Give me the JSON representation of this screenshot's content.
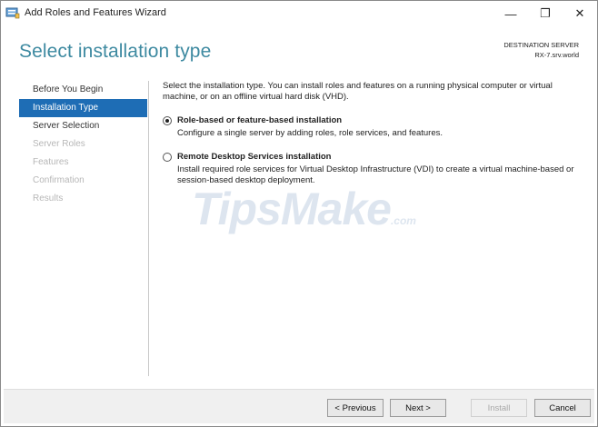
{
  "window": {
    "title": "Add Roles and Features Wizard",
    "controls": {
      "minimize": "—",
      "maximize": "❐",
      "close": "✕"
    }
  },
  "header": {
    "title": "Select installation type",
    "destination_label": "DESTINATION SERVER",
    "destination_server": "RX-7.srv.world"
  },
  "nav": {
    "items": [
      {
        "label": "Before You Begin",
        "state": "normal"
      },
      {
        "label": "Installation Type",
        "state": "active"
      },
      {
        "label": "Server Selection",
        "state": "normal"
      },
      {
        "label": "Server Roles",
        "state": "disabled"
      },
      {
        "label": "Features",
        "state": "disabled"
      },
      {
        "label": "Confirmation",
        "state": "disabled"
      },
      {
        "label": "Results",
        "state": "disabled"
      }
    ]
  },
  "content": {
    "intro": "Select the installation type. You can install roles and features on a running physical computer or virtual machine, or on an offline virtual hard disk (VHD).",
    "options": [
      {
        "title": "Role-based or feature-based installation",
        "description": "Configure a single server by adding roles, role services, and features.",
        "selected": true
      },
      {
        "title": "Remote Desktop Services installation",
        "description": "Install required role services for Virtual Desktop Infrastructure (VDI) to create a virtual machine-based or session-based desktop deployment.",
        "selected": false
      }
    ]
  },
  "watermark": {
    "text": "TipsMake",
    "suffix": ".com"
  },
  "footer": {
    "previous": "< Previous",
    "next": "Next >",
    "install": "Install",
    "cancel": "Cancel"
  },
  "colors": {
    "accent": "#1e6db5",
    "title": "#3e8aa1",
    "footer_bg": "#f0f0f0"
  }
}
